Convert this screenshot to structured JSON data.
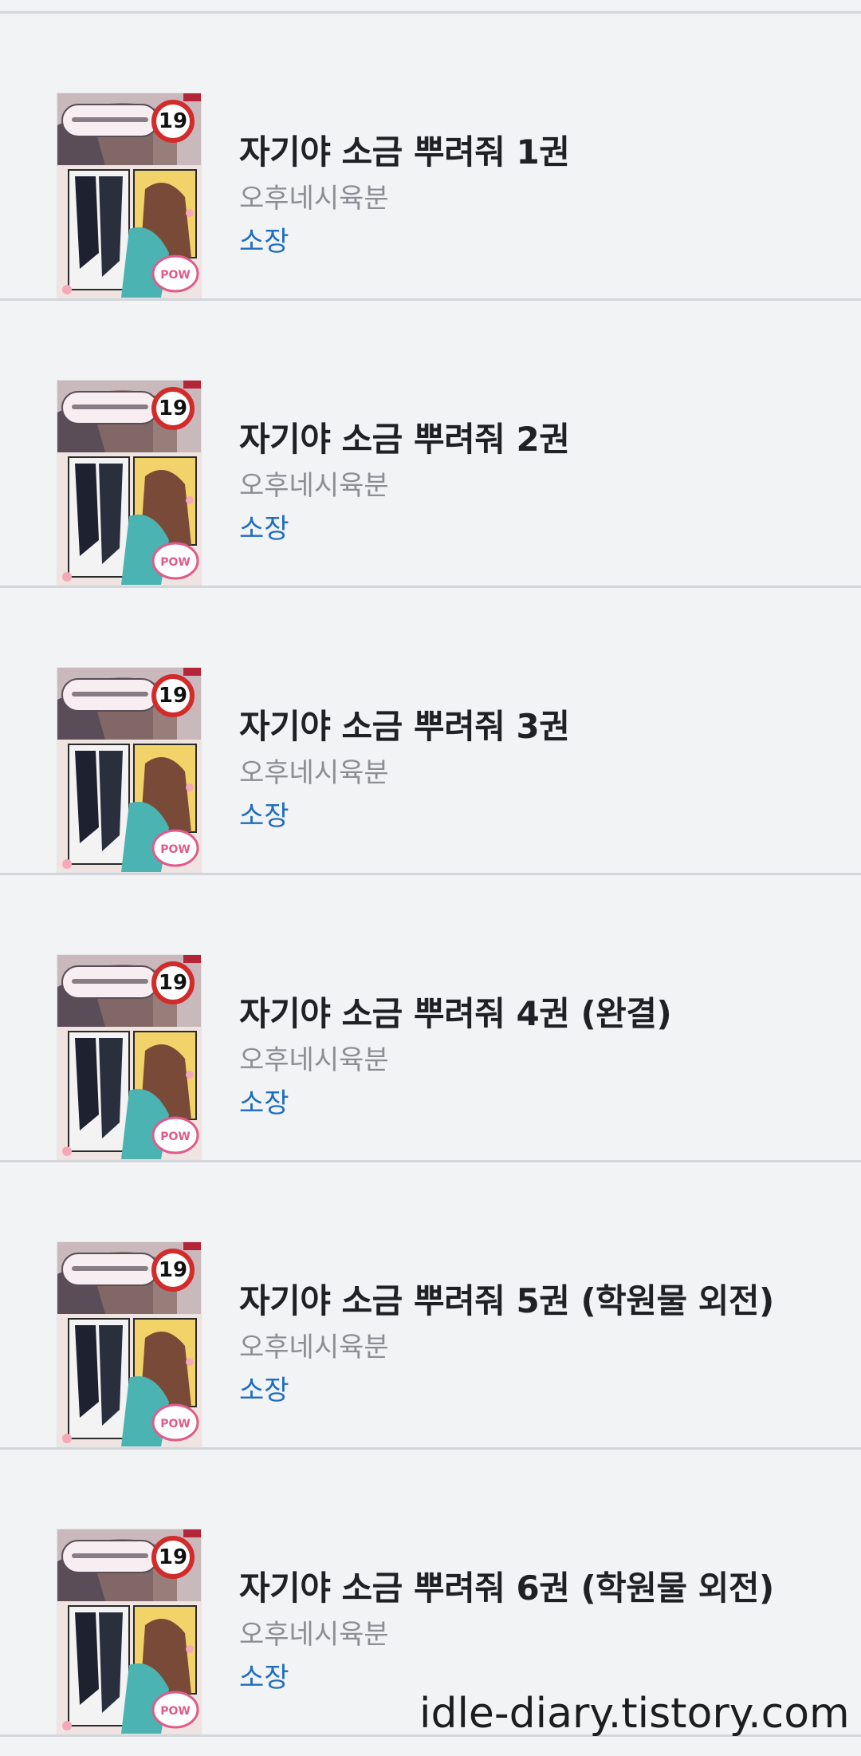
{
  "items": [
    {
      "title": "자기야 소금 뿌려줘 1권",
      "author": "오후네시육분",
      "status": "소장",
      "rating_badge": "19"
    },
    {
      "title": "자기야 소금 뿌려줘 2권",
      "author": "오후네시육분",
      "status": "소장",
      "rating_badge": "19"
    },
    {
      "title": "자기야 소금 뿌려줘 3권",
      "author": "오후네시육분",
      "status": "소장",
      "rating_badge": "19"
    },
    {
      "title": "자기야 소금 뿌려줘 4권 (완결)",
      "author": "오후네시육분",
      "status": "소장",
      "rating_badge": "19"
    },
    {
      "title": "자기야 소금 뿌려줘 5권 (학원물 외전)",
      "author": "오후네시육분",
      "status": "소장",
      "rating_badge": "19"
    },
    {
      "title": "자기야 소금 뿌려줘 6권 (학원물 외전)",
      "author": "오후네시육분",
      "status": "소장",
      "rating_badge": "19"
    }
  ],
  "watermark": "idle-diary.tistory.com",
  "colors": {
    "background": "#f2f3f5",
    "divider": "#d4d6da",
    "title": "#1f2125",
    "author": "#8b8e93",
    "owned": "#1e6dc0",
    "badge_ring": "#d22b2b"
  }
}
